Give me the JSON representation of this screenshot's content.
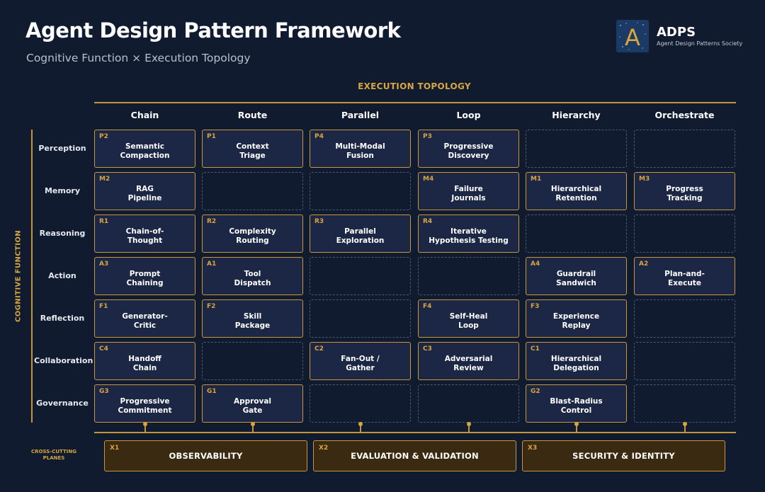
{
  "header": {
    "title": "Agent Design Pattern Framework",
    "subtitle": "Cognitive Function × Execution Topology"
  },
  "brand": {
    "logo_icon": "letter-a-constellation-icon",
    "logo_letter": "A",
    "name": "ADPS",
    "full_name": "Agent Design Patterns Society"
  },
  "axes": {
    "columns_label": "EXECUTION TOPOLOGY",
    "rows_label": "COGNITIVE FUNCTION"
  },
  "columns": [
    "Chain",
    "Route",
    "Parallel",
    "Loop",
    "Hierarchy",
    "Orchestrate"
  ],
  "rows": [
    "Perception",
    "Memory",
    "Reasoning",
    "Action",
    "Reflection",
    "Collaboration",
    "Governance"
  ],
  "grid": [
    [
      {
        "code": "P2",
        "name": "Semantic\nCompaction"
      },
      {
        "code": "P1",
        "name": "Context\nTriage"
      },
      {
        "code": "P4",
        "name": "Multi-Modal\nFusion"
      },
      {
        "code": "P3",
        "name": "Progressive\nDiscovery"
      },
      null,
      null
    ],
    [
      {
        "code": "M2",
        "name": "RAG\nPipeline"
      },
      null,
      null,
      {
        "code": "M4",
        "name": "Failure\nJournals"
      },
      {
        "code": "M1",
        "name": "Hierarchical\nRetention"
      },
      {
        "code": "M3",
        "name": "Progress\nTracking"
      }
    ],
    [
      {
        "code": "R1",
        "name": "Chain-of-\nThought"
      },
      {
        "code": "R2",
        "name": "Complexity\nRouting"
      },
      {
        "code": "R3",
        "name": "Parallel\nExploration"
      },
      {
        "code": "R4",
        "name": "Iterative\nHypothesis Testing"
      },
      null,
      null
    ],
    [
      {
        "code": "A3",
        "name": "Prompt\nChaining"
      },
      {
        "code": "A1",
        "name": "Tool\nDispatch"
      },
      null,
      null,
      {
        "code": "A4",
        "name": "Guardrail\nSandwich"
      },
      {
        "code": "A2",
        "name": "Plan-and-\nExecute"
      }
    ],
    [
      {
        "code": "F1",
        "name": "Generator-\nCritic"
      },
      {
        "code": "F2",
        "name": "Skill\nPackage"
      },
      null,
      {
        "code": "F4",
        "name": "Self-Heal\nLoop"
      },
      {
        "code": "F3",
        "name": "Experience\nReplay"
      },
      null
    ],
    [
      {
        "code": "C4",
        "name": "Handoff\nChain"
      },
      null,
      {
        "code": "C2",
        "name": "Fan-Out /\nGather"
      },
      {
        "code": "C3",
        "name": "Adversarial\nReview"
      },
      {
        "code": "C1",
        "name": "Hierarchical\nDelegation"
      },
      null
    ],
    [
      {
        "code": "G3",
        "name": "Progressive\nCommitment"
      },
      {
        "code": "G1",
        "name": "Approval\nGate"
      },
      null,
      null,
      {
        "code": "G2",
        "name": "Blast-Radius\nControl"
      },
      null
    ]
  ],
  "cross_cutting": {
    "label": "CROSS-CUTTING\nPLANES",
    "planes": [
      {
        "code": "X1",
        "name": "OBSERVABILITY"
      },
      {
        "code": "X2",
        "name": "EVALUATION & VALIDATION"
      },
      {
        "code": "X3",
        "name": "SECURITY & IDENTITY"
      }
    ]
  },
  "colors": {
    "background": "#101b2f",
    "accent_gold": "#c9973a",
    "cell_fill": "#1b2745",
    "plane_fill": "#3a2a11",
    "empty_border": "#4b5a72"
  }
}
